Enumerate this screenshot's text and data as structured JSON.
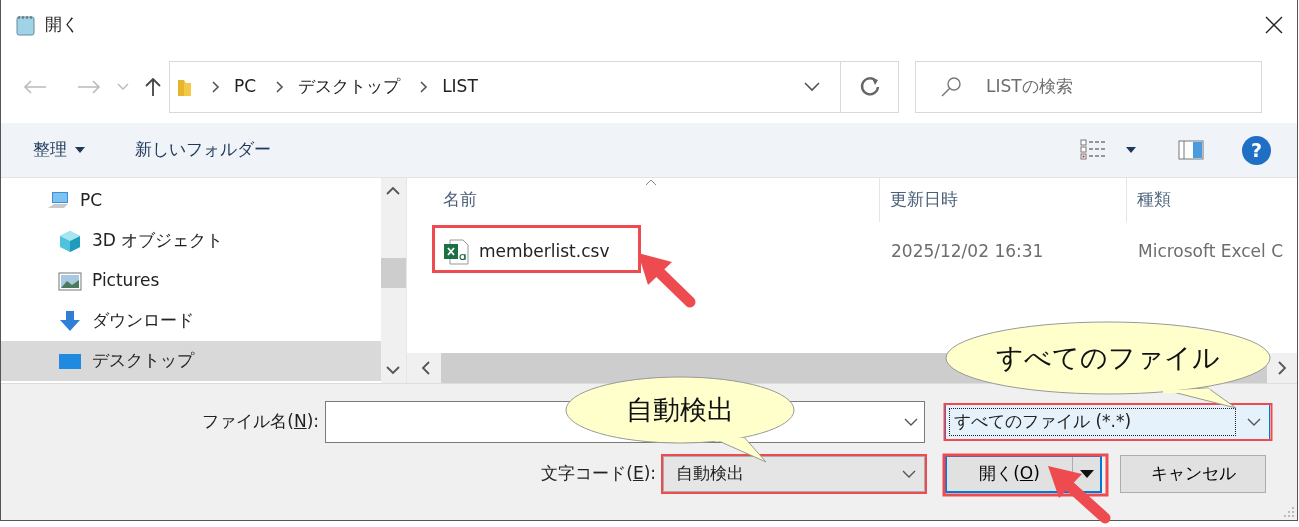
{
  "window": {
    "title": "開く"
  },
  "address": {
    "path": [
      "PC",
      "デスクトップ",
      "LIST"
    ]
  },
  "search": {
    "placeholder": "LISTの検索"
  },
  "toolbar": {
    "organize": "整理",
    "new_folder": "新しいフォルダー",
    "help": "?"
  },
  "sidebar": {
    "items": [
      {
        "label": "PC",
        "kind": "computer",
        "selected": false,
        "children": [
          {
            "label": "3D オブジェクト",
            "kind": "cube",
            "selected": false
          },
          {
            "label": "Pictures",
            "kind": "image",
            "selected": false
          },
          {
            "label": "ダウンロード",
            "kind": "download",
            "selected": false
          },
          {
            "label": "デスクトップ",
            "kind": "desktop",
            "selected": true
          }
        ]
      }
    ]
  },
  "file_list": {
    "columns": [
      {
        "label": "名前",
        "sorted": true
      },
      {
        "label": "更新日時",
        "sorted": false
      },
      {
        "label": "種類",
        "sorted": false
      }
    ],
    "rows": [
      {
        "name": "memberlist.csv",
        "modified": "2025/12/02 16:31",
        "type": "Microsoft Excel C",
        "selected": false
      }
    ]
  },
  "form": {
    "file_name": {
      "label": {
        "before": "ファイル名(",
        "key": "N",
        "after": "):"
      }
    },
    "file_type": {
      "value": "すべてのファイル  (*.*)",
      "focused": true
    },
    "encoding": {
      "label": {
        "before": "文字コード(",
        "key": "E",
        "after": "):"
      },
      "value": "自動検出"
    },
    "buttons": [
      {
        "kind": "split",
        "default": true,
        "label": {
          "before": "開く(",
          "key": "O",
          "after": ")"
        }
      },
      {
        "kind": "plain",
        "default": false,
        "label": {
          "before": "キャンセル"
        }
      }
    ]
  },
  "annotations": {
    "callouts": [
      {
        "text": "すべてのファイル"
      },
      {
        "text": "自動検出"
      }
    ]
  }
}
